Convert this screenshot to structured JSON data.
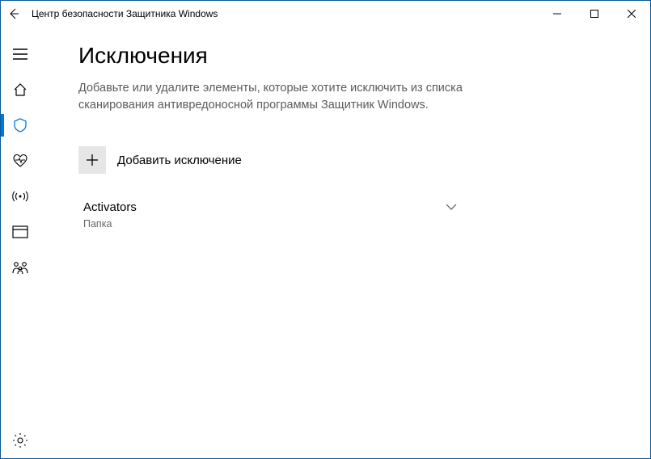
{
  "titlebar": {
    "title": "Центр безопасности Защитника Windows"
  },
  "sidebar": {
    "items": [
      {
        "name": "menu-icon"
      },
      {
        "name": "home-icon"
      },
      {
        "name": "shield-icon",
        "active": true
      },
      {
        "name": "heart-icon"
      },
      {
        "name": "antenna-icon"
      },
      {
        "name": "app-icon"
      },
      {
        "name": "family-icon"
      }
    ],
    "footer": {
      "name": "settings-icon"
    }
  },
  "main": {
    "title": "Исключения",
    "description": "Добавьте или удалите элементы, которые хотите исключить из списка сканирования антивредоносной программы Защитник Windows.",
    "add_label": "Добавить исключение",
    "exclusions": [
      {
        "name": "Activators",
        "type": "Папка"
      }
    ]
  }
}
